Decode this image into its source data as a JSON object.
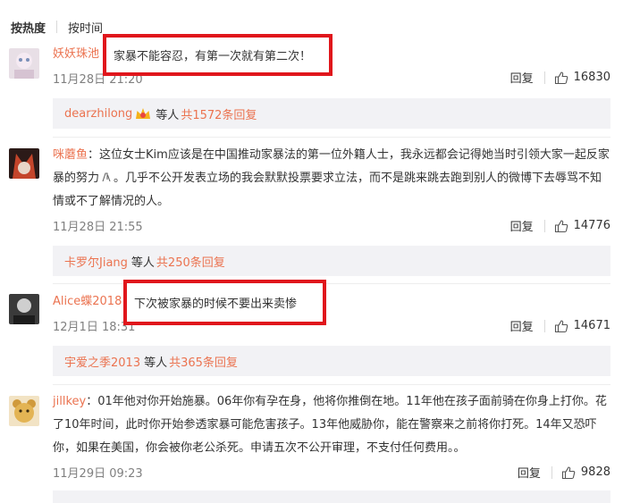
{
  "sort": {
    "hot": "按热度",
    "time": "按时间"
  },
  "colors": {
    "username": "#eb7350",
    "highlight_border": "#e0161c",
    "subreply_bg": "#f2f2f5"
  },
  "comments": [
    {
      "username": "妖妖珠池",
      "text": "家暴不能容忍，有第一次就有第二次！",
      "time": "11月28日 21:20",
      "reply_label": "回复",
      "likes": "16830",
      "subreply": {
        "user": "dearzhilong",
        "mid": "等人",
        "count": "共1572条回复"
      }
    },
    {
      "username": "咪蘑鱼",
      "text": "：这位女士Kim应该是在中国推动家暴法的第一位外籍人士，我永远都会记得她当时引领大家一起反家暴的努力",
      "text2": "。几乎不公开发表立场的我会默默投票要求立法，而不是跳来跳去跑到别人的微博下去辱骂不知情或不了解情况的人。",
      "time": "11月28日 21:55",
      "reply_label": "回复",
      "likes": "14776",
      "subreply": {
        "user": "卡罗尔Jiang",
        "mid": "等人",
        "count": "共250条回复"
      }
    },
    {
      "username": "Alice蝶2018",
      "text": "下次被家暴的时候不要出来卖惨",
      "time": "12月1日 18:31",
      "reply_label": "回复",
      "likes": "14671",
      "subreply": {
        "user": "宇爱之季2013",
        "mid": "等人",
        "count": "共365条回复"
      }
    },
    {
      "username": "jillkey",
      "text": "：01年他对你开始施暴。06年你有孕在身，他将你推倒在地。11年他在孩子面前骑在你身上打你。花了10年时间，此时你开始参透家暴可能危害孩子。13年他威胁你，能在警察来之前将你打死。14年又恐吓你，如果在美国，你会被你老公杀死。申请五次不公开审理，不支付任何费用。。",
      "time": "11月29日 09:23",
      "reply_label": "回复",
      "likes": "9828"
    }
  ]
}
